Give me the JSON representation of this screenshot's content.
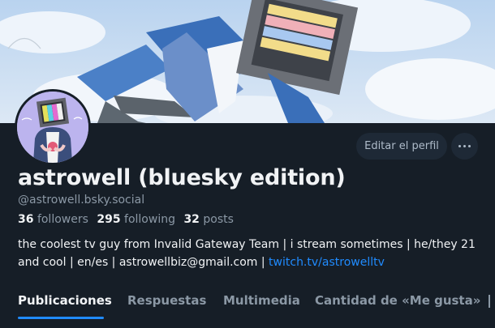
{
  "profile": {
    "display_name": "astrowell (bluesky edition)",
    "handle": "@astrowell.bsky.social",
    "stats": {
      "followers_count": "36",
      "followers_label": "followers",
      "following_count": "295",
      "following_label": "following",
      "posts_count": "32",
      "posts_label": "posts"
    },
    "bio_text": "the coolest tv guy from Invalid Gateway Team | i stream sometimes | he/they 21 and cool | en/es | astrowellbiz@gmail.com | ",
    "bio_link": "twitch.tv/astrowelltv"
  },
  "actions": {
    "edit_profile_label": "Editar el perfil",
    "more_icon": "ellipsis-icon"
  },
  "tabs": [
    {
      "label": "Publicaciones",
      "active": true
    },
    {
      "label": "Respuestas",
      "active": false
    },
    {
      "label": "Multimedia",
      "active": false
    },
    {
      "label": "Cantidad de «Me gusta»",
      "active": false
    }
  ],
  "colors": {
    "background": "#161e27",
    "accent": "#208bfe",
    "muted_text": "#8b98a5",
    "button_bg": "#1e2936"
  }
}
